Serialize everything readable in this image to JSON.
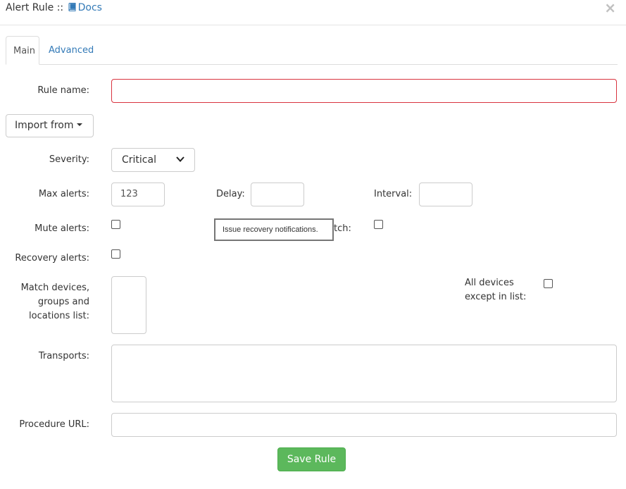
{
  "header": {
    "title": "Alert Rule",
    "separator": "::",
    "docs_label": "Docs",
    "close_symbol": "×"
  },
  "tabs": [
    {
      "label": "Main",
      "active": true
    },
    {
      "label": "Advanced",
      "active": false
    }
  ],
  "form": {
    "rule_name": {
      "label": "Rule name:",
      "value": ""
    },
    "import_from": {
      "label": "Import from"
    },
    "severity": {
      "label": "Severity:",
      "value": "Critical"
    },
    "max_alerts": {
      "label": "Max alerts:",
      "value": "123"
    },
    "delay": {
      "label": "Delay:",
      "value": ""
    },
    "interval": {
      "label": "Interval:",
      "value": ""
    },
    "mute_alerts": {
      "label": "Mute alerts:",
      "checked": false
    },
    "invert_match": {
      "label_visible": "tch:",
      "checked": false
    },
    "recovery_alerts": {
      "label": "Recovery alerts:",
      "checked": false
    },
    "match_devices": {
      "label_line1": "Match devices,",
      "label_line2": "groups and",
      "label_line3": "locations list:"
    },
    "all_devices_except": {
      "label_line1": "All devices",
      "label_line2": "except in list:",
      "checked": false
    },
    "transports": {
      "label": "Transports:"
    },
    "procedure_url": {
      "label": "Procedure URL:",
      "value": ""
    },
    "save_label": "Save Rule"
  },
  "tooltip": {
    "text": "Issue recovery notifications."
  },
  "colors": {
    "link": "#337ab7",
    "error_border": "#d9333f",
    "success": "#5cb85c"
  }
}
